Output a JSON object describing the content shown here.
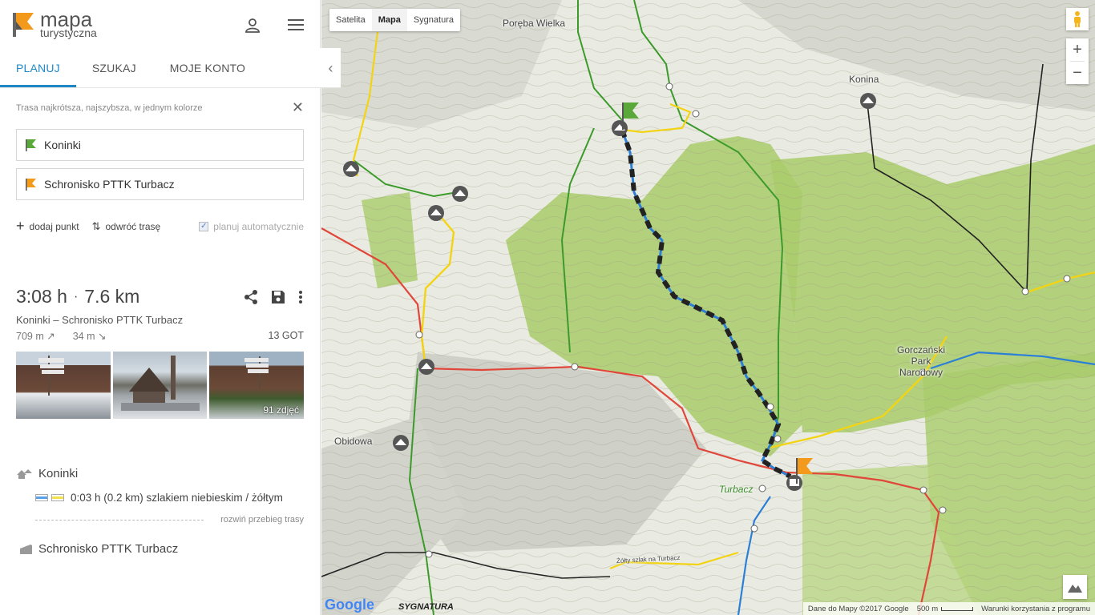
{
  "logo": {
    "line1": "mapa",
    "line2": "turystyczna"
  },
  "tabs": [
    {
      "label": "PLANUJ"
    },
    {
      "label": "SZUKAJ"
    },
    {
      "label": "MOJE KONTO"
    }
  ],
  "planner": {
    "hint": "Trasa najkrótsza, najszybsza, w jednym kolorze",
    "from": "Koninki",
    "to": "Schronisko PTTK Turbacz",
    "add_point": "dodaj punkt",
    "reverse": "odwróć trasę",
    "auto": "planuj automatycznie",
    "auto_checked": true
  },
  "summary": {
    "time": "3:08 h",
    "sep": "·",
    "distance": "7.6 km",
    "route_name": "Koninki – Schronisko PTTK Turbacz",
    "ascent": "709 m ↗",
    "descent": "34 m ↘",
    "got": "13 GOT",
    "photo_count": "91 zdjęć"
  },
  "itinerary": {
    "start": "Koninki",
    "segment": "0:03 h (0.2 km) szlakiem niebieskim / żółtym",
    "segment_colors": [
      "#5aa0e6",
      "#f2e24a"
    ],
    "expand": "rozwiń przebieg trasy",
    "end": "Schronisko PTTK Turbacz"
  },
  "map": {
    "types": [
      {
        "label": "Satelita"
      },
      {
        "label": "Mapa"
      },
      {
        "label": "Sygnatura"
      }
    ],
    "active_type": "Mapa",
    "labels": {
      "poreba": "Poręba Wielka",
      "konina": "Konina",
      "gorcz1": "Gorczański",
      "gorcz2": "Park",
      "gorcz3": "Narodowy",
      "obidowa": "Obidowa",
      "turbacz": "Turbacz",
      "yellow_trail": "Żółty szlak na Turbacz"
    },
    "google": "Google",
    "sygnatura": "SYGNATURA",
    "attribution": "Dane do Mapy ©2017 Google",
    "scale": "500 m",
    "terms": "Warunki korzystania z programu",
    "colors": {
      "accent": "#1e88c7",
      "trail_red": "#e0463a",
      "trail_green": "#3c9a2b",
      "trail_yellow": "#f2d414",
      "trail_blue": "#2c7fd6",
      "forest": "#a9cc6b"
    }
  }
}
